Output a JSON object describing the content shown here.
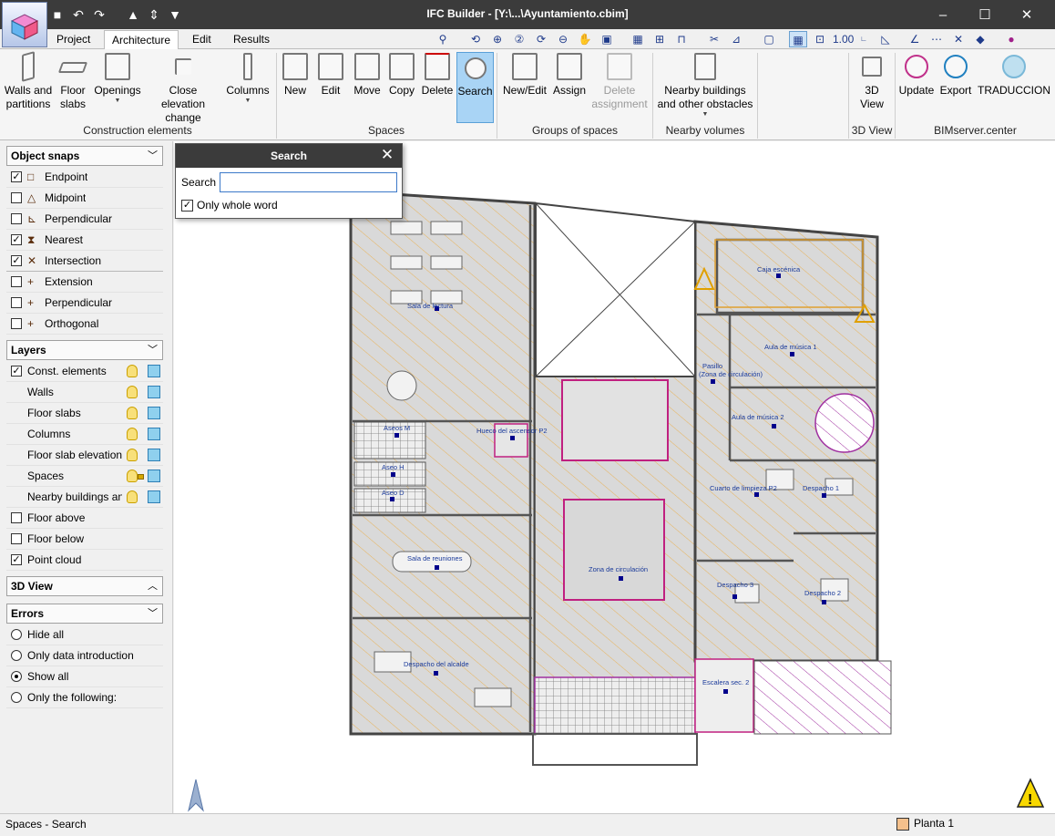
{
  "window": {
    "title": "IFC Builder - [Y:\\...\\Ayuntamiento.cbim]",
    "minimize": "–",
    "maximize": "☐",
    "close": "✕"
  },
  "quick_access": {
    "save": "■",
    "undo": "↶",
    "redo": "↷",
    "up": "▲",
    "updown": "⇕",
    "down": "▼"
  },
  "menu": {
    "tabs": [
      "Project",
      "Architecture",
      "Edit",
      "Results"
    ],
    "active": "Architecture"
  },
  "toolbar_icons": [
    "⚲",
    "⟲",
    "⊕",
    "②",
    "⟳",
    "⊖",
    "✋",
    "▣",
    "▦",
    "⊞",
    "⊓",
    "✂",
    "⊿",
    "▢",
    "▦",
    "⊡",
    "1.00",
    "∟",
    "◺",
    "∠",
    "⋯",
    "✕",
    "◆",
    "●"
  ],
  "ribbon": {
    "groups": {
      "construction": "Construction elements",
      "spaces": "Spaces",
      "groups_of_spaces": "Groups of spaces",
      "nearby_volumes": "Nearby volumes",
      "view3d": "3D View",
      "bimserver": "BIMserver.center"
    },
    "buttons": {
      "walls": "Walls and partitions",
      "floor_slabs": "Floor slabs",
      "openings": "Openings",
      "close_elevation": "Close elevation change",
      "columns": "Columns",
      "new": "New",
      "edit": "Edit",
      "move": "Move",
      "copy": "Copy",
      "delete": "Delete",
      "search": "Search",
      "new_edit": "New/Edit",
      "assign": "Assign",
      "delete_assignment": "Delete assignment",
      "nearby": "Nearby buildings and other obstacles",
      "view3d": "3D View",
      "update": "Update",
      "export": "Export",
      "traduccion": "TRADUCCION"
    }
  },
  "object_snaps": {
    "title": "Object snaps",
    "items": [
      {
        "label": "Endpoint",
        "checked": true,
        "icon": "□"
      },
      {
        "label": "Midpoint",
        "checked": false,
        "icon": "△"
      },
      {
        "label": "Perpendicular",
        "checked": false,
        "icon": "⊾"
      },
      {
        "label": "Nearest",
        "checked": true,
        "icon": "⧗"
      },
      {
        "label": "Intersection",
        "checked": true,
        "icon": "✕"
      },
      {
        "label": "Extension",
        "checked": false,
        "icon": "+"
      },
      {
        "label": "Perpendicular",
        "checked": false,
        "icon": "+"
      },
      {
        "label": "Orthogonal",
        "checked": false,
        "icon": "+"
      }
    ]
  },
  "layers": {
    "title": "Layers",
    "items": [
      {
        "label": "Const. elements",
        "checked": true
      },
      {
        "label": "Walls"
      },
      {
        "label": "Floor slabs"
      },
      {
        "label": "Columns"
      },
      {
        "label": "Floor slab elevation"
      },
      {
        "label": "Spaces",
        "locked": true
      },
      {
        "label": "Nearby buildings and"
      },
      {
        "label": "Floor above",
        "checked": false
      },
      {
        "label": "Floor below",
        "checked": false
      },
      {
        "label": "Point cloud",
        "checked": true
      }
    ]
  },
  "view3d_panel": {
    "title": "3D View"
  },
  "errors": {
    "title": "Errors",
    "options": [
      "Hide all",
      "Only data introduction",
      "Show all",
      "Only the following:"
    ],
    "selected": "Show all"
  },
  "search_dialog": {
    "title": "Search",
    "close": "✕",
    "label": "Search",
    "value": "",
    "whole_word": "Only whole word",
    "whole_word_checked": true
  },
  "plan": {
    "rooms": [
      "Sala de lectura",
      "Caja escénica",
      "Aula de música 1",
      "Pasillo",
      "(Zona de circulación)",
      "Aula de música 2",
      "Aseos M",
      "Hueco del ascensor P2",
      "Aseo H",
      "Aseo D",
      "Cuarto de limpieza P2",
      "Despacho 1",
      "Sala de reuniones",
      "Zona de circulación",
      "Despacho 3",
      "Despacho 2",
      "Despacho del alcalde",
      "Escalera sec. 2"
    ]
  },
  "status": {
    "left": "Spaces - Search",
    "floor": "Planta 1"
  },
  "colors": {
    "titlebar": "#3b3b3b",
    "accent": "#a9d4f5",
    "hatch": "#e8b35a",
    "space_fill": "#d9d9d9"
  }
}
